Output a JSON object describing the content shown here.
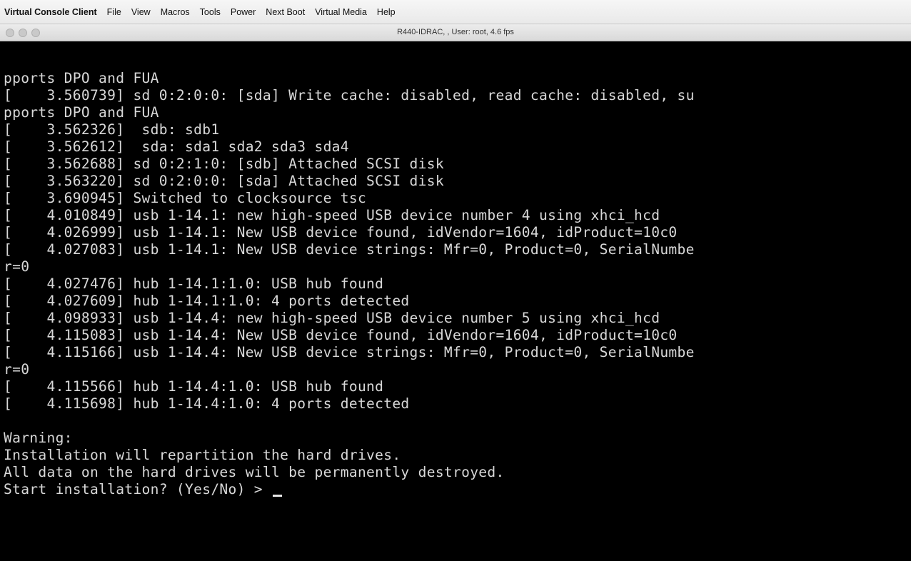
{
  "menubar": {
    "app_name": "Virtual Console Client",
    "items": [
      "File",
      "View",
      "Macros",
      "Tools",
      "Power",
      "Next Boot",
      "Virtual Media",
      "Help"
    ]
  },
  "window": {
    "title": "R440-IDRAC, , User: root, 4.6 fps"
  },
  "console": {
    "lines": [
      "pports DPO and FUA",
      "[    3.560739] sd 0:2:0:0: [sda] Write cache: disabled, read cache: disabled, su",
      "pports DPO and FUA",
      "[    3.562326]  sdb: sdb1",
      "[    3.562612]  sda: sda1 sda2 sda3 sda4",
      "[    3.562688] sd 0:2:1:0: [sdb] Attached SCSI disk",
      "[    3.563220] sd 0:2:0:0: [sda] Attached SCSI disk",
      "[    3.690945] Switched to clocksource tsc",
      "[    4.010849] usb 1-14.1: new high-speed USB device number 4 using xhci_hcd",
      "[    4.026999] usb 1-14.1: New USB device found, idVendor=1604, idProduct=10c0",
      "[    4.027083] usb 1-14.1: New USB device strings: Mfr=0, Product=0, SerialNumbe",
      "r=0",
      "[    4.027476] hub 1-14.1:1.0: USB hub found",
      "[    4.027609] hub 1-14.1:1.0: 4 ports detected",
      "[    4.098933] usb 1-14.4: new high-speed USB device number 5 using xhci_hcd",
      "[    4.115083] usb 1-14.4: New USB device found, idVendor=1604, idProduct=10c0",
      "[    4.115166] usb 1-14.4: New USB device strings: Mfr=0, Product=0, SerialNumbe",
      "r=0",
      "[    4.115566] hub 1-14.4:1.0: USB hub found",
      "[    4.115698] hub 1-14.4:1.0: 4 ports detected",
      "",
      "Warning:",
      "Installation will repartition the hard drives.",
      "All data on the hard drives will be permanently destroyed.",
      "Start installation? (Yes/No) > "
    ],
    "colors": {
      "background": "#000000",
      "text": "#d8d8d8"
    }
  }
}
